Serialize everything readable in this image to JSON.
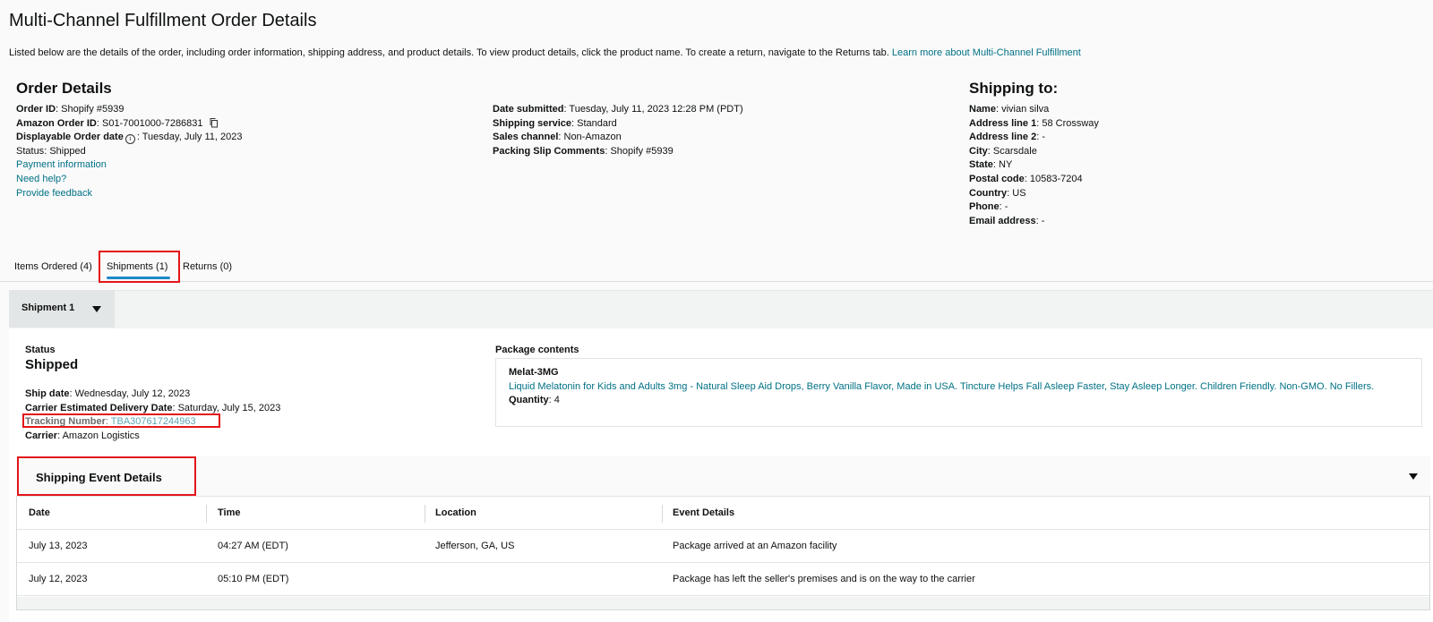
{
  "page": {
    "title": "Multi-Channel Fulfillment Order Details",
    "intro": "Listed below are the details of the order, including order information, shipping address, and product details. To view product details, click the product name. To create a return, navigate to the Returns tab.",
    "intro_link": "Learn more about Multi-Channel Fulfillment"
  },
  "order": {
    "heading": "Order Details",
    "order_id_label": "Order ID",
    "order_id": "Shopify #5939",
    "amazon_order_id_label": "Amazon Order ID",
    "amazon_order_id": "S01-7001000-7286831",
    "displayable_date_label": "Displayable Order date",
    "displayable_date": "Tuesday, July 11, 2023",
    "status_label": "Status",
    "status": "Shipped",
    "payment_link": "Payment information",
    "help_link": "Need help?",
    "feedback_link": "Provide feedback"
  },
  "submission": {
    "date_submitted_label": "Date submitted",
    "date_submitted": "Tuesday, July 11, 2023 12:28 PM (PDT)",
    "shipping_service_label": "Shipping service",
    "shipping_service": "Standard",
    "sales_channel_label": "Sales channel",
    "sales_channel": "Non-Amazon",
    "packing_slip_label": "Packing Slip Comments",
    "packing_slip": "Shopify #5939"
  },
  "shipping_to": {
    "heading": "Shipping to:",
    "name_label": "Name",
    "name": "vivian silva",
    "address1_label": "Address line 1",
    "address1": "58 Crossway",
    "address2_label": "Address line 2",
    "address2": "-",
    "city_label": "City",
    "city": "Scarsdale",
    "state_label": "State",
    "state": "NY",
    "postal_label": "Postal code",
    "postal": "10583-7204",
    "country_label": "Country",
    "country": "US",
    "phone_label": "Phone",
    "phone": "-",
    "email_label": "Email address",
    "email": "-"
  },
  "tabs": {
    "items": "Items Ordered (4)",
    "shipments": "Shipments (1)",
    "returns": "Returns (0)"
  },
  "shipment": {
    "tab_label": "Shipment 1",
    "status_label": "Status",
    "status": "Shipped",
    "ship_date_label": "Ship date",
    "ship_date": "Wednesday, July 12, 2023",
    "est_delivery_label": "Carrier Estimated Delivery Date",
    "est_delivery": "Saturday, July 15, 2023",
    "tracking_label": "Tracking Number",
    "tracking": "TBA307617244963",
    "carrier_label": "Carrier",
    "carrier": "Amazon Logistics",
    "package_heading": "Package contents",
    "sku": "Melat-3MG",
    "product_name": "Liquid Melatonin for Kids and Adults 3mg - Natural Sleep Aid Drops, Berry Vanilla Flavor, Made in USA. Tincture Helps Fall Asleep Faster, Stay Asleep Longer. Children Friendly. Non-GMO. No Fillers.",
    "quantity_label": "Quantity",
    "quantity": "4"
  },
  "events": {
    "heading": "Shipping Event Details",
    "columns": [
      "Date",
      "Time",
      "Location",
      "Event Details"
    ],
    "rows": [
      [
        "July 13, 2023",
        "04:27 AM (EDT)",
        "Jefferson, GA, US",
        "Package arrived at an Amazon facility"
      ],
      [
        "July 12, 2023",
        "05:10 PM (EDT)",
        "",
        "Package has left the seller's premises and is on the way to the carrier"
      ]
    ]
  },
  "colors": {
    "link": "#007185",
    "highlight_box": "#e3151a",
    "active_tab_underline": "#1e88c7"
  }
}
